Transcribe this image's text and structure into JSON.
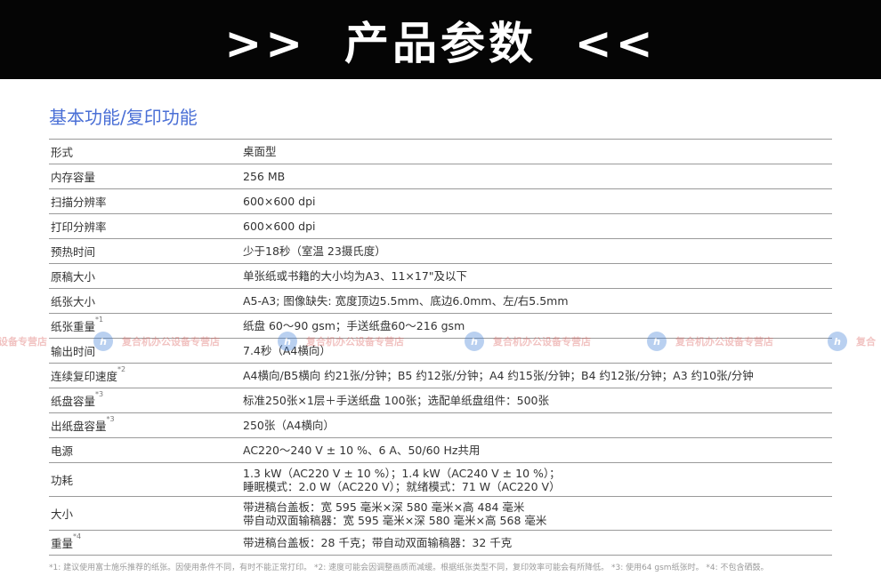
{
  "banner": {
    "title": ">>  产品参数  <<"
  },
  "section": {
    "title": "基本功能/复印功能"
  },
  "specs": [
    {
      "label": "形式",
      "lines": [
        "桌面型"
      ]
    },
    {
      "label": "内存容量",
      "lines": [
        "256 MB"
      ]
    },
    {
      "label": "扫描分辨率",
      "lines": [
        "600×600 dpi"
      ]
    },
    {
      "label": "打印分辨率",
      "lines": [
        "600×600 dpi"
      ]
    },
    {
      "label": "预热时间",
      "lines": [
        "少于18秒（室温 23摄氏度）"
      ]
    },
    {
      "label": "原稿大小",
      "lines": [
        "单张纸或书籍的大小均为A3、11×17\"及以下"
      ]
    },
    {
      "label": "纸张大小",
      "lines": [
        "A5-A3; 图像缺失: 宽度顶边5.5mm、底边6.0mm、左/右5.5mm"
      ]
    },
    {
      "label": "纸张重量",
      "mark": "*1",
      "lines": [
        "纸盘 60～90 gsm；手送纸盘60～216 gsm"
      ]
    },
    {
      "label": "输出时间",
      "lines": [
        "7.4秒（A4横向）"
      ]
    },
    {
      "label": "连续复印速度",
      "mark": "*2",
      "lines": [
        "A4横向/B5横向 约21张/分钟；B5 约12张/分钟；A4 约15张/分钟；B4 约12张/分钟；A3 约10张/分钟"
      ]
    },
    {
      "label": "纸盘容量",
      "mark": "*3",
      "lines": [
        "标准250张×1层＋手送纸盘 100张；选配单纸盘组件：500张"
      ]
    },
    {
      "label": "出纸盘容量",
      "mark": "*3",
      "lines": [
        "250张（A4横向）"
      ]
    },
    {
      "label": "电源",
      "lines": [
        "AC220～240 V ± 10 %、6 A、50/60 Hz共用"
      ]
    },
    {
      "label": "功耗",
      "lines": [
        "1.3 kW（AC220 V ± 10 %）；1.4 kW（AC240 V ± 10 %）；",
        "睡眠模式：2.0 W（AC220 V）；就绪模式：71 W（AC220 V）"
      ]
    },
    {
      "label": "大小",
      "lines": [
        "带进稿台盖板：宽 595 毫米×深 580 毫米×高 484 毫米",
        "带自动双面输稿器：宽 595 毫米×深 580 毫米×高 568 毫米"
      ]
    },
    {
      "label": "重量",
      "mark": "*4",
      "lines": [
        "带进稿台盖板：28 千克；带自动双面输稿器：32 千克"
      ]
    }
  ],
  "footnotes": "*1: 建议使用富士施乐推荐的纸张。因使用条件不同，有时不能正常打印。 *2: 速度可能会因调整画质而减缓。根据纸张类型不同，复印效率可能会有所降低。 *3: 使用64 gsm纸张时。 *4: 不包含硒鼓。",
  "watermark": {
    "text": "复合机办公设备专营店",
    "partial_text": "设备专营店",
    "partial_right_text": "复合",
    "logo_glyph": "h"
  },
  "colors": {
    "banner_bg": "#050505",
    "section_title": "#4a6fd6",
    "watermark_text": "#d9534f",
    "watermark_logo": "#3a7bd5"
  }
}
